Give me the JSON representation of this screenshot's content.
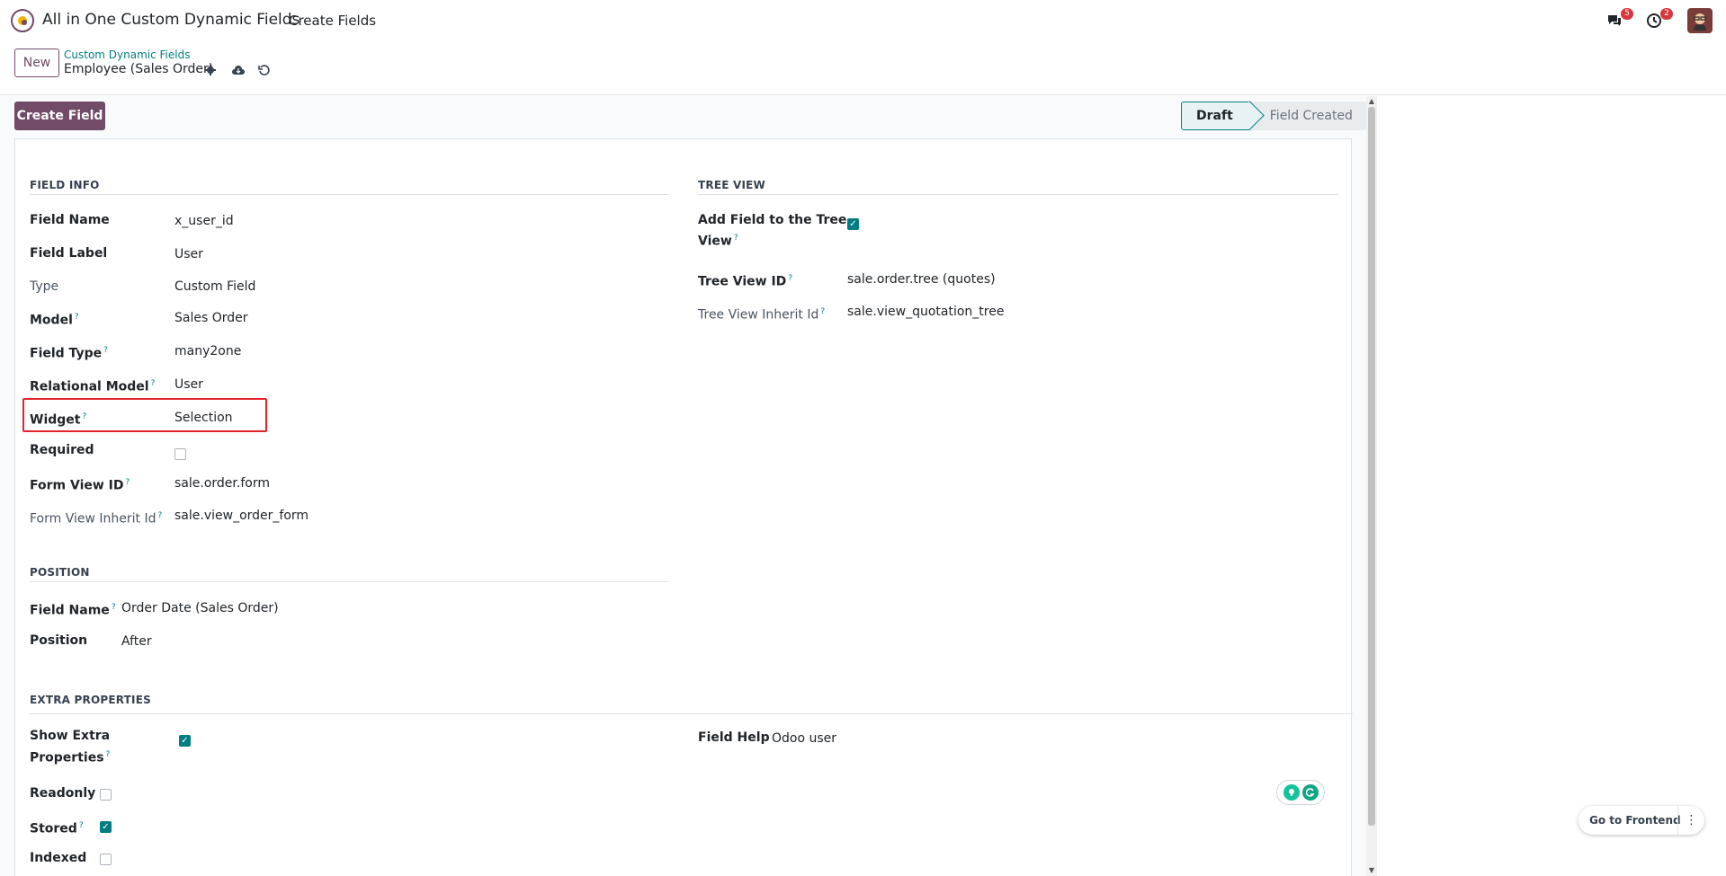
{
  "navbar": {
    "app_title": "All in One Custom Dynamic Fields",
    "menu_item": "Create Fields",
    "messages_count": "5",
    "activities_count": "2"
  },
  "control": {
    "new_label": "New",
    "breadcrumb_parent": "Custom Dynamic Fields",
    "breadcrumb_current": "Employee (Sales Order)"
  },
  "actions": {
    "create_field_label": "Create Field"
  },
  "statusbar": {
    "current": "Draft",
    "next": "Field Created"
  },
  "field_info": {
    "title": "FIELD INFO",
    "field_name_label": "Field Name",
    "field_name": "x_user_id",
    "field_label_label": "Field Label",
    "field_label": "User",
    "type_label": "Type",
    "type": "Custom Field",
    "model_label": "Model",
    "model": "Sales Order",
    "field_type_label": "Field Type",
    "field_type": "many2one",
    "relational_model_label": "Relational Model",
    "relational_model": "User",
    "widget_label": "Widget",
    "widget": "Selection",
    "required_label": "Required",
    "form_view_id_label": "Form View ID",
    "form_view_id": "sale.order.form",
    "form_view_inherit_label": "Form View Inherit Id",
    "form_view_inherit": "sale.view_order_form"
  },
  "tree_view": {
    "title": "TREE VIEW",
    "add_field_label_1": "Add Field to the Tree",
    "add_field_label_2": "View",
    "tree_view_id_label": "Tree View ID",
    "tree_view_id": "sale.order.tree (quotes)",
    "tree_view_inherit_label": "Tree View Inherit Id",
    "tree_view_inherit": "sale.view_quotation_tree"
  },
  "position": {
    "title": "POSITION",
    "field_name_label": "Field Name",
    "field_name": "Order Date (Sales Order)",
    "position_label": "Position",
    "position": "After"
  },
  "extra": {
    "title": "EXTRA PROPERTIES",
    "show_extra_label_1": "Show Extra",
    "show_extra_label_2": "Properties",
    "readonly_label": "Readonly",
    "stored_label": "Stored",
    "indexed_label": "Indexed",
    "field_help_label": "Field Help",
    "field_help": "Odoo user"
  },
  "help_marker": "?",
  "frontend": {
    "label": "Go to Frontend"
  },
  "colors": {
    "brand": "#714b67",
    "accent": "#017e84",
    "highlight": "#e3242b"
  }
}
